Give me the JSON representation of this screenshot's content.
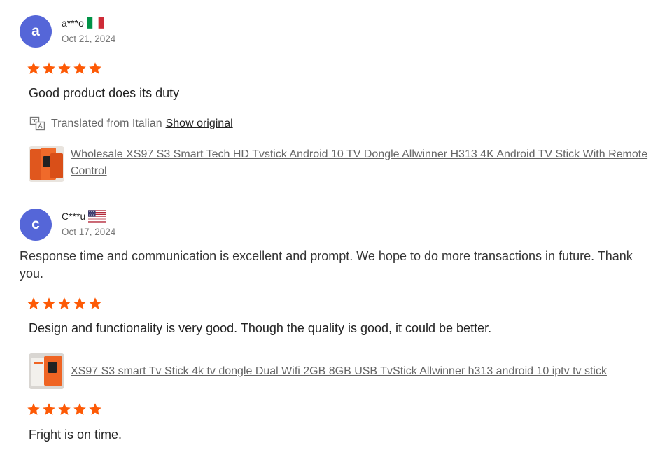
{
  "reviews": [
    {
      "avatar_letter": "a",
      "avatar_color": "#5566d8",
      "user": "a***o",
      "flag": "italy-flag-icon",
      "date": "Oct 21, 2024",
      "main_comment": "",
      "followups": [
        {
          "rating": 5,
          "text": "Good product does its duty",
          "translation": {
            "label": "Translated from Italian",
            "link": "Show original"
          },
          "product": {
            "title": "Wholesale XS97 S3 Smart Tech HD Tvstick Android 10 TV Dongle Allwinner H313 4K Android TV Stick With Remote Control",
            "thumb": "tv-stick-box-stack-icon"
          }
        }
      ]
    },
    {
      "avatar_letter": "c",
      "avatar_color": "#5566d8",
      "user": "C***u",
      "flag": "usa-flag-icon",
      "date": "Oct 17, 2024",
      "main_comment": "Response time and communication is excellent and prompt. We hope to do more transactions in future. Thank you.",
      "followups": [
        {
          "rating": 5,
          "text": "Design and functionality is very good. Though the quality is good, it could be better.",
          "product": {
            "title": "XS97 S3 smart Tv Stick 4k tv dongle Dual Wifi 2GB 8GB USB TvStick Allwinner h313 android 10 iptv tv stick",
            "thumb": "tv-stick-box-icon"
          }
        },
        {
          "rating": 5,
          "text": "Fright is on time."
        }
      ]
    }
  ],
  "colors": {
    "star": "#fd5a06",
    "avatar": "#5566d8",
    "link": "#666666"
  }
}
